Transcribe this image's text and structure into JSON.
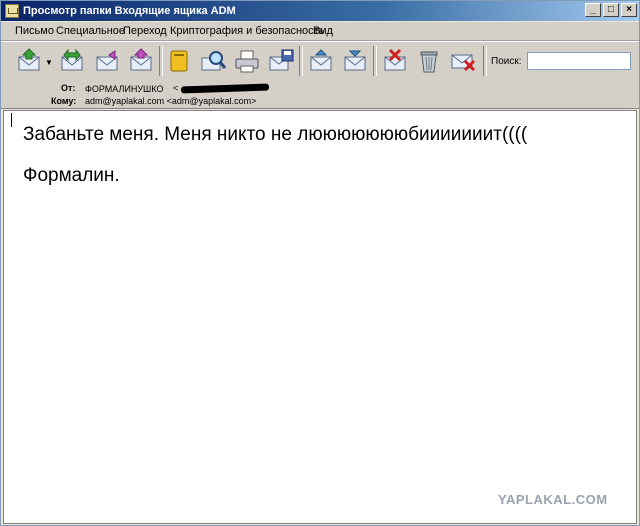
{
  "window": {
    "title": "Просмотр папки Входящие ящика ADM",
    "minimize": "_",
    "maximize": "□",
    "close": "×"
  },
  "menu": {
    "items": [
      "Письмо",
      "Специальное",
      "Переход",
      "Криптография и безопасность",
      "Вид"
    ]
  },
  "toolbar": {
    "icons": [
      "get-mail-icon",
      "send-receive-icon",
      "reply-icon",
      "forward-icon",
      "address-book-icon",
      "find-icon",
      "print-icon",
      "save-icon",
      "previous-icon",
      "next-icon",
      "delete-icon",
      "trash-icon",
      "junk-icon"
    ],
    "dropdown_glyph": "▼",
    "search_label": "Поиск:",
    "search_value": ""
  },
  "headers": {
    "from_label": "От:",
    "from_name": "ФОРМАЛИНУШКО",
    "from_bracket": "<",
    "to_label": "Кому:",
    "to_value": "adm@yaplakal.com <adm@yaplakal.com>"
  },
  "message": {
    "line1": "Забаньте меня. Меня никто не люююююююбииииииит((((",
    "line2": "Формалин."
  },
  "watermark": "YAPLAKAL.COM"
}
